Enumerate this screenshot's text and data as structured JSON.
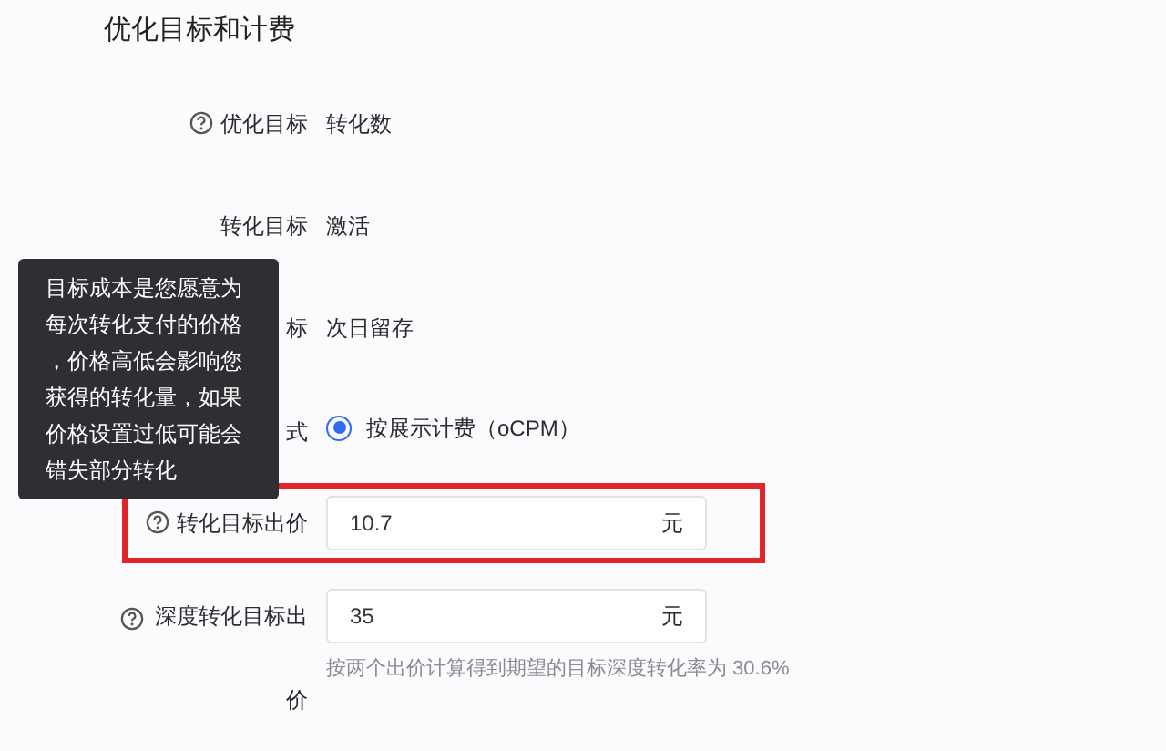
{
  "section_title": "优化目标和计费",
  "rows": [
    {
      "kind": "text",
      "label": "优化目标",
      "help": true,
      "value": "转化数"
    },
    {
      "kind": "text",
      "label": "转化目标",
      "help": false,
      "value": "激活"
    },
    {
      "kind": "text",
      "label": "标",
      "help": false,
      "value": "次日留存"
    },
    {
      "kind": "radio",
      "label": "式",
      "help": false,
      "options": [
        {
          "label": "按展示计费（oCPM）",
          "selected": true
        }
      ]
    },
    {
      "kind": "input",
      "label": "转化目标出价",
      "help": true,
      "value": "10.7",
      "unit": "元",
      "highlighted": true
    },
    {
      "kind": "input",
      "label": "深度转化目标出价",
      "help": true,
      "value": "35",
      "unit": "元",
      "highlighted": false,
      "hint": "按两个出价计算得到期望的目标深度转化率为 30.6%"
    }
  ],
  "tooltip": {
    "text": "目标成本是您愿意为每次转化支付的价格，价格高低会影响您获得的转化量，如果价格设置过低可能会错失部分转化"
  }
}
